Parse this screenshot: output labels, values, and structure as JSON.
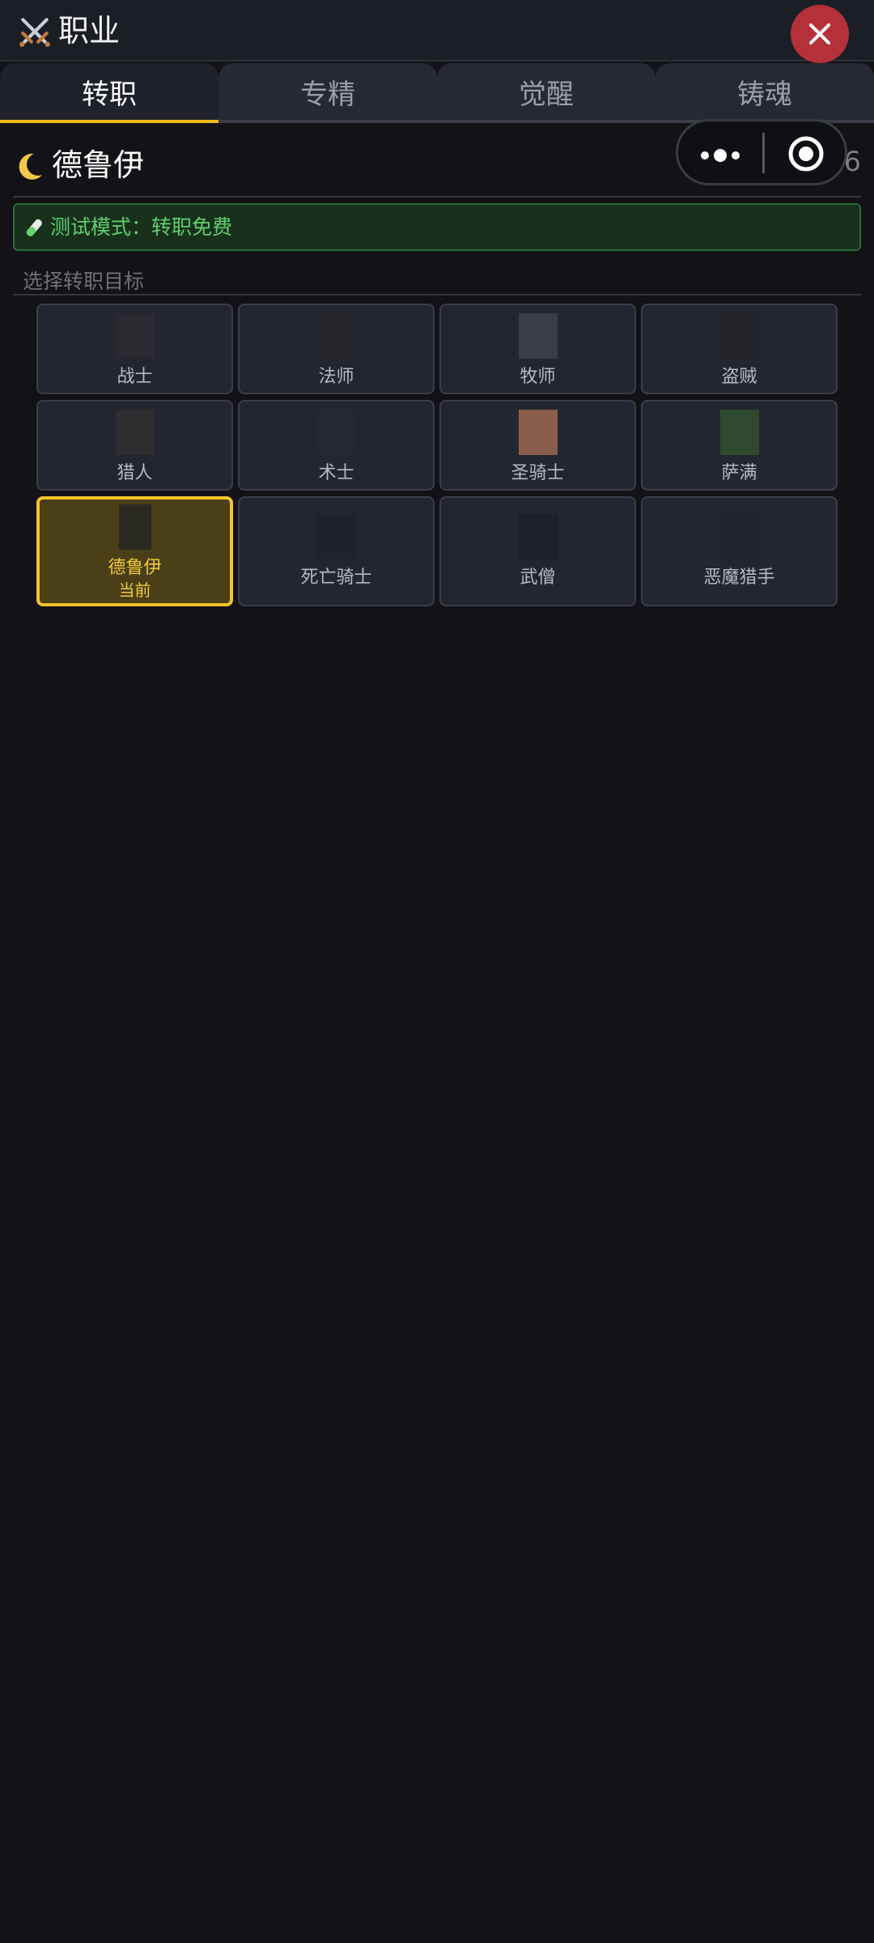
{
  "header": {
    "title": "职业",
    "icon": "crossed-swords-icon",
    "close_icon": "close-icon"
  },
  "tabs": [
    {
      "label": "转职",
      "active": true
    },
    {
      "label": "专精",
      "active": false
    },
    {
      "label": "觉醒",
      "active": false
    },
    {
      "label": "铸魂",
      "active": false
    }
  ],
  "class_header": {
    "name": "德鲁伊",
    "icon": "moon-icon",
    "level": "Lv.6"
  },
  "notice": {
    "icon": "test-tube-icon",
    "text": "测试模式：转职免费"
  },
  "section": {
    "label": "选择转职目标"
  },
  "classes": [
    {
      "name": "战士",
      "thumb_color": "#2a2a30"
    },
    {
      "name": "法师",
      "thumb_color": "#26262c"
    },
    {
      "name": "牧师",
      "thumb_color": "#3a3d47"
    },
    {
      "name": "盗贼",
      "thumb_color": "#232429"
    },
    {
      "name": "猎人",
      "thumb_color": "#2e2d30"
    },
    {
      "name": "术士",
      "thumb_color": "#262830"
    },
    {
      "name": "圣骑士",
      "thumb_color": "#8a5e4b"
    },
    {
      "name": "萨满",
      "thumb_color": "#2f4a2f"
    },
    {
      "name": "德鲁伊",
      "sub": "当前",
      "current": true,
      "thumb_color": "#2b2a22"
    },
    {
      "name": "死亡骑士",
      "thumb_color": "#20222a"
    },
    {
      "name": "武僧",
      "thumb_color": "#1f2128"
    },
    {
      "name": "恶魔猎手",
      "thumb_color": "#22242c"
    }
  ],
  "colors": {
    "accent": "#f0b818",
    "close": "#b5313a",
    "notice_text": "#5fcf6c"
  }
}
